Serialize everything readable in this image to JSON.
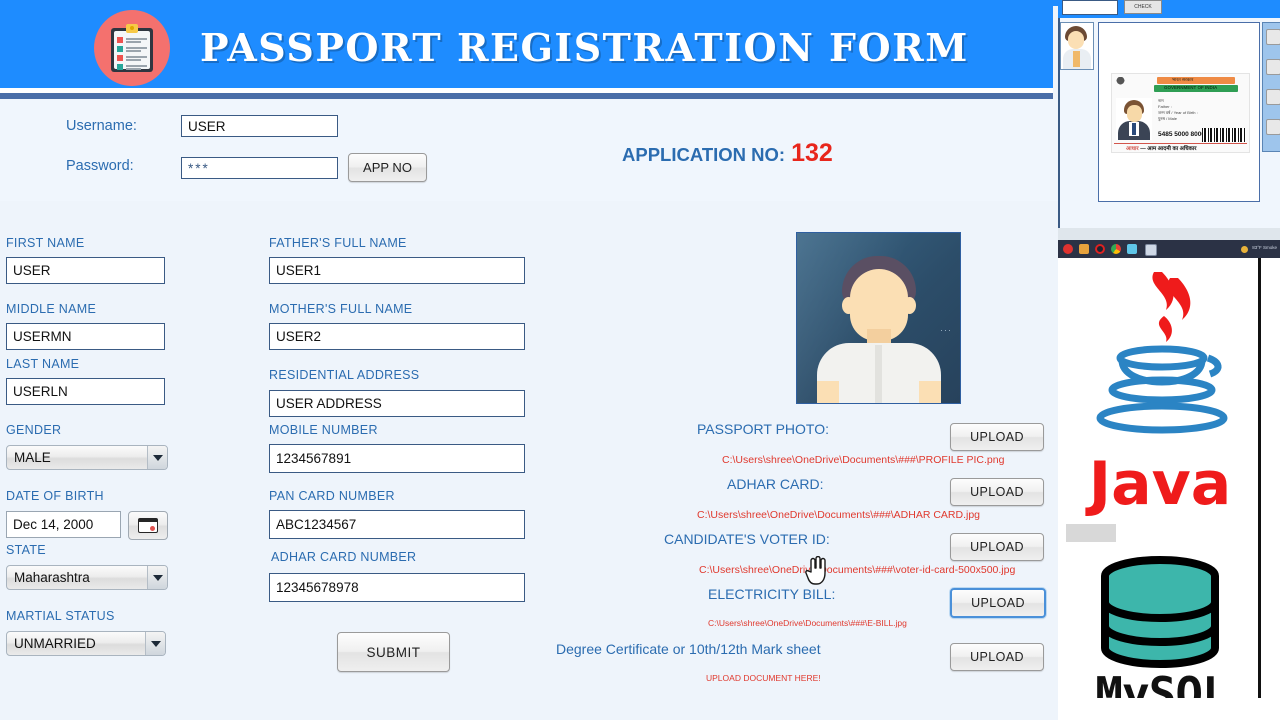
{
  "header": {
    "title": "PASSPORT REGISTRATION FORM",
    "logo_icon": "clipboard-checklist-icon",
    "banner_color": "#1e8cff",
    "title_color": "#ffffff"
  },
  "login": {
    "username_label": "Username:",
    "username_value": "USER",
    "password_label": "Password:",
    "password_value": "***",
    "app_no_button": "APP NO",
    "application_no_label": "APPLICATION NO:",
    "application_no_value": "132",
    "application_no_color": "#e8261c"
  },
  "form": {
    "left_column": [
      {
        "label": "FIRST NAME",
        "value": "USER",
        "type": "text"
      },
      {
        "label": "MIDDLE NAME",
        "value": "USERMN",
        "type": "text"
      },
      {
        "label": "LAST NAME",
        "value": "USERLN",
        "type": "text"
      },
      {
        "label": "GENDER",
        "value": "MALE",
        "type": "combo"
      },
      {
        "label": "DATE OF BIRTH",
        "value": "Dec 14, 2000",
        "type": "date"
      },
      {
        "label": "STATE",
        "value": "Maharashtra",
        "type": "combo"
      },
      {
        "label": "MARTIAL STATUS",
        "value": "UNMARRIED",
        "type": "combo"
      }
    ],
    "middle_column": [
      {
        "label": "FATHER'S FULL NAME",
        "value": "USER1"
      },
      {
        "label": "MOTHER'S FULL NAME",
        "value": "USER2"
      },
      {
        "label": "RESIDENTIAL ADDRESS",
        "value": "USER ADDRESS"
      },
      {
        "label": "MOBILE NUMBER",
        "value": "1234567891"
      },
      {
        "label": "PAN CARD NUMBER",
        "value": "ABC1234567"
      },
      {
        "label": "ADHAR CARD NUMBER",
        "value": "12345678978"
      }
    ],
    "submit_button": "SUBMIT",
    "label_color": "#2b6cb0"
  },
  "uploads": {
    "photo_alt": "passport-photo-placeholder",
    "rows": [
      {
        "label": "PASSPORT PHOTO:",
        "path": "C:\\Users\\shree\\OneDrive\\Documents\\###\\PROFILE PIC.png",
        "button": "UPLOAD"
      },
      {
        "label": "ADHAR CARD:",
        "path": "C:\\Users\\shree\\OneDrive\\Documents\\###\\ADHAR CARD.jpg",
        "button": "UPLOAD"
      },
      {
        "label": "CANDIDATE'S VOTER ID:",
        "path": "C:\\Users\\shree\\OneDrive\\Documents\\###\\voter-id-card-500x500.jpg",
        "button": "UPLOAD"
      },
      {
        "label": "ELECTRICITY BILL:",
        "path": "C:\\Users\\shree\\OneDrive\\Documents\\###\\E-BILL.jpg",
        "button": "UPLOAD"
      },
      {
        "label": "Degree Certificate or 10th/12th  Mark sheet",
        "path": "UPLOAD DOCUMENT HERE!",
        "button": "UPLOAD"
      }
    ],
    "path_color": "#e0392e"
  },
  "background_window": {
    "check_button": "CHECK",
    "aadhaar": {
      "gov_hindi": "भारत सरकार",
      "gov_english": "GOVERNMENT OF INDIA",
      "name_hindi": "नाम",
      "father_label": "Father :",
      "dob_label": "जन्म वर्ष / Year of Birth :",
      "gender_label": "पुरुष / Male",
      "uid_number": "5485 5000 8000",
      "slogan_prefix": "आधार",
      "slogan": "— आम आदमी का अधिकार"
    }
  },
  "taskbar": {
    "weather": "83°F Smoke",
    "app_icons": [
      "opera-icon",
      "notes-icon",
      "record-icon",
      "chrome-icon",
      "gem-icon",
      "contact-icon"
    ]
  },
  "tech_logos": {
    "java_label": "Java",
    "java_color": "#ef1b1b",
    "mysql_label": "MySQL",
    "mysql_color": "#3db6ab"
  }
}
